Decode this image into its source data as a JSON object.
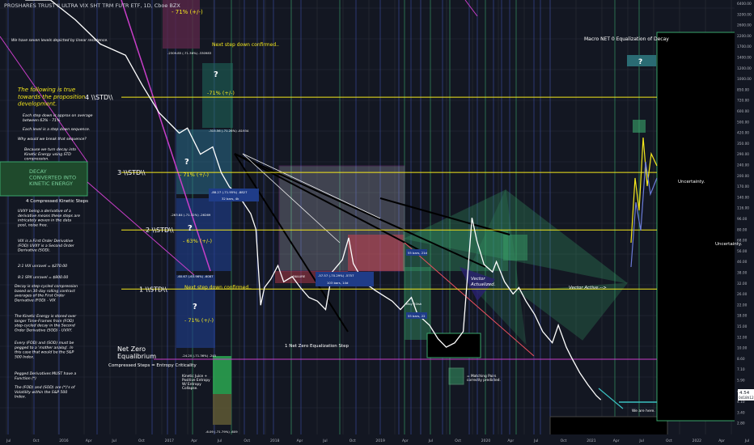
{
  "chart_data": {
    "type": "line",
    "title": "PROSHARES TRUST II ULTRA VIX SHT TRM FUTR ETF, 1D, Cboe BZX",
    "y_scale": "log",
    "ylim": [
      2.4,
      7200
    ],
    "x_range": [
      "2015-07-01",
      "2022-11-01"
    ],
    "y_ticks": [
      "6400.00",
      "3200.00",
      "2600.00",
      "2200.00",
      "1700.00",
      "1400.00",
      "1200.00",
      "1000.00",
      "850.00",
      "720.00",
      "600.00",
      "500.00",
      "420.00",
      "350.00",
      "290.00",
      "240.00",
      "200.00",
      "170.00",
      "140.00",
      "116.00",
      "96.00",
      "80.00",
      "68.00",
      "56.00",
      "46.00",
      "38.00",
      "32.00",
      "26.00",
      "22.00",
      "18.00",
      "15.00",
      "12.00",
      "10.00",
      "8.60",
      "7.10",
      "5.90",
      "4.90",
      "4.10",
      "3.40",
      "2.80"
    ],
    "x_ticks": [
      "Jul",
      "Oct",
      "2016",
      "Apr",
      "Jul",
      "Oct",
      "2017",
      "Apr",
      "Jul",
      "Oct",
      "2018",
      "Apr",
      "Jul",
      "Oct",
      "2019",
      "Apr",
      "Jul",
      "Oct",
      "2020",
      "Apr",
      "Jul",
      "Oct",
      "2021",
      "Apr",
      "Jul",
      "Oct",
      "2022",
      "Apr",
      "Jul"
    ],
    "last_price": "4.54",
    "last_price_sub": "0d18h12m",
    "series": [
      {
        "points": [
          [
            "2015-10-01",
            12000
          ],
          [
            "2016-01-01",
            8500
          ],
          [
            "2016-04-01",
            5000
          ],
          [
            "2016-07-01",
            3200
          ],
          [
            "2016-10-01",
            2600
          ],
          [
            "2016-12-01",
            1500
          ],
          [
            "2017-02-01",
            900
          ],
          [
            "2017-04-15",
            620
          ],
          [
            "2017-05-15",
            680
          ],
          [
            "2017-07-01",
            420
          ],
          [
            "2017-08-15",
            480
          ],
          [
            "2017-09-15",
            300
          ],
          [
            "2017-10-15",
            230
          ],
          [
            "2017-11-15",
            200
          ],
          [
            "2018-01-01",
            140
          ],
          [
            "2018-01-20",
            105
          ],
          [
            "2018-02-06",
            26
          ],
          [
            "2018-02-20",
            36
          ],
          [
            "2018-03-15",
            42
          ],
          [
            "2018-04-10",
            54
          ],
          [
            "2018-05-01",
            40
          ],
          [
            "2018-06-01",
            44
          ],
          [
            "2018-07-01",
            36
          ],
          [
            "2018-08-01",
            30
          ],
          [
            "2018-09-01",
            28
          ],
          [
            "2018-10-01",
            24
          ],
          [
            "2018-10-25",
            48
          ],
          [
            "2018-12-01",
            60
          ],
          [
            "2018-12-24",
            90
          ],
          [
            "2019-01-10",
            56
          ],
          [
            "2019-02-01",
            46
          ],
          [
            "2019-03-01",
            38
          ],
          [
            "2019-04-01",
            34
          ],
          [
            "2019-05-10",
            30
          ],
          [
            "2019-06-01",
            28
          ],
          [
            "2019-07-01",
            24
          ],
          [
            "2019-08-10",
            30
          ],
          [
            "2019-09-01",
            22
          ],
          [
            "2019-10-15",
            18
          ],
          [
            "2019-11-15",
            14
          ],
          [
            "2019-12-15",
            12
          ],
          [
            "2020-01-15",
            13
          ],
          [
            "2020-02-15",
            16
          ],
          [
            "2020-03-18",
            130
          ],
          [
            "2020-04-05",
            85
          ],
          [
            "2020-05-01",
            55
          ],
          [
            "2020-06-01",
            48
          ],
          [
            "2020-06-15",
            58
          ],
          [
            "2020-07-15",
            40
          ],
          [
            "2020-08-15",
            32
          ],
          [
            "2020-09-05",
            36
          ],
          [
            "2020-10-01",
            28
          ],
          [
            "2020-11-01",
            22
          ],
          [
            "2020-12-01",
            16
          ],
          [
            "2021-01-05",
            13
          ],
          [
            "2021-01-27",
            18
          ],
          [
            "2021-02-25",
            12
          ],
          [
            "2021-03-15",
            10
          ],
          [
            "2021-04-15",
            7.5
          ],
          [
            "2021-05-15",
            6
          ],
          [
            "2021-06-15",
            4.9
          ],
          [
            "2021-07-01",
            4.54
          ]
        ]
      }
    ],
    "levels": [
      {
        "label": "4 \\\\STD\\\\",
        "value": 1200
      },
      {
        "label": "3 \\\\STD\\\\",
        "value": 300
      },
      {
        "label": "2 \\\\STD\\\\",
        "value": 104
      },
      {
        "label": "1 \\\\STD\\\\",
        "value": 35
      },
      {
        "label": "Net Zero Equalibrium",
        "value": 9.6
      }
    ],
    "annotations": {
      "top_pct": "- 71% (+/-)",
      "step_down": "Next step down confirmed..",
      "macro": "Macro NET 0 Equalization of Decay",
      "qmark": "?",
      "pct_71_a": "-71% (+/-)",
      "pct_71_b": "- 71% (+/-)",
      "pct_63": "- 63% (+/-)",
      "pct_71_c": "- 71% (+/-)",
      "uncertainty_1": "Uncertainty.",
      "uncertainty_2": "Uncertainty.",
      "vector_actualized": "Vector\nActualized.",
      "vector_active": "Vector Active.-->",
      "net_zero_eq_step": "1 Net Zero Equalization Step",
      "compressed_steps": "Compressed Steps = Entropy Criticality",
      "kinetic_juice": "Kinetic Juice +\nPositive Entropy\nW/ Entropy\nCollapse.",
      "matching_pairs": "= Matching Pairs\ncorrectly predicted.",
      "we_are_here": "We are here.",
      "decay_box": "DECAY\nCONVERTED INTO\nKINETIC ENERGY",
      "four_compressed": "4 Compressed Kinetic Steps",
      "measure_a": "-2309.85 (-71.36%) -330983",
      "measure_b": "-315.56 (-71.26%) -81934",
      "measure_c": "-263.84 (-71.32%) -26269",
      "measure_d": "-60.67 (-63.96%) -6087",
      "measure_e": "-24.20 (-71.36%) -245",
      "measure_f": "-6.09 (-71.79%) -609",
      "measure_g": "-88.27 (-71.95%) -8827",
      "measure_h": "-57.57 (-70.29%) -5757",
      "bars_a": "32 bars, 4k",
      "bars_b": "103 bars, 14d",
      "bars_c": "55 bars, 21d",
      "bars_d": "55 bars, 22",
      "failure": "FAILURE",
      "may": "May 20ish"
    },
    "left_notes": [
      "We have seven levels depicted by linear resistence.",
      "The following is true towards the proposition development.",
      "Each step down is approx on average between 63% - 71%.",
      "Each level is a step down sequence.",
      "Why would we break that sequence?",
      "Because we turn decay into Kinetic Energy using STD compression.",
      "UVXY being a derivative of a derivative means these steps are intricately woven in the data pool, noise free.",
      "VIX is a First Order Derivative (FOD) UVXY is a Second Order Derivative (SOD).",
      "2:1 VIX unravel = $270.00",
      "8:1 SPX unravel = $800.00",
      "Decay is step-cycled compression based on 30-day rolling contract averages of the First Order Derivative (FOD) - VIX",
      "The Kinetic Energy is stored over longer Time-Frames from (FOD) step-cycled decay in the Second Order Derivative (SOD) - UVXY.",
      "Every (FOD) and (SOD) must be pegged to a 'mother analog'. In this case that would be the S&P 500 Index.",
      "Pegged Derivatives MUST have a Function (*)",
      "The (FOD) and (SOD) are (*)'s of Volatility within the S&P 500 Index."
    ]
  },
  "colors": {
    "background": "#131722",
    "price": "#ffffff",
    "level": "#f5e81d",
    "grid": "#2a2e39",
    "vline_blue": "#3c4ea8",
    "vline_green": "#3aa66c",
    "magenta": "#c83ec8",
    "teal_box": "#2a6b73",
    "green_box": "#2aa04f",
    "red_box": "#c8404f",
    "navy_box": "#1f3c88"
  }
}
